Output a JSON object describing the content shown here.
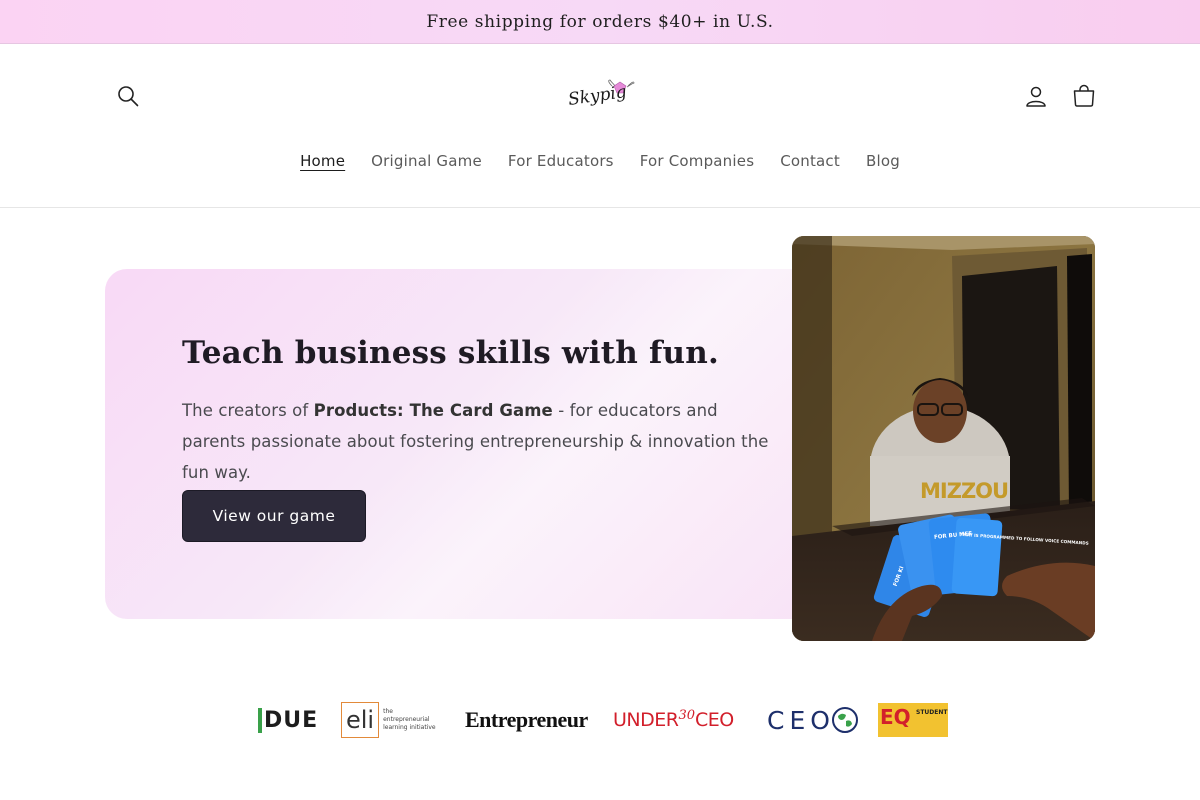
{
  "announcement": {
    "text": "Free shipping for orders $40+ in U.S."
  },
  "header": {
    "logo_text": "Skypig",
    "icons": {
      "search": "search-icon",
      "account": "account-icon",
      "cart": "cart-icon"
    }
  },
  "nav": {
    "items": [
      {
        "label": "Home",
        "active": true
      },
      {
        "label": "Original Game"
      },
      {
        "label": "For Educators"
      },
      {
        "label": "For Companies"
      },
      {
        "label": "Contact"
      },
      {
        "label": "Blog"
      }
    ]
  },
  "hero": {
    "title": "Teach business skills with fun.",
    "desc_prefix": "The creators of ",
    "desc_product": "Products: The Card Game",
    "desc_suffix": " - for educators and parents passionate about fostering entrepreneurship & innovation the fun way.",
    "button_label": "View our game",
    "photo": {
      "sweatshirt_text": "MIZZOU",
      "card_texts": [
        "FOR KI",
        "FOR BU MEE",
        "THAT IS PROGRAMMED TO FOLLOW VOICE COMMANDS"
      ]
    }
  },
  "press_logos": [
    {
      "name": "DUE",
      "text": "DUE"
    },
    {
      "name": "eli",
      "text": "eli",
      "sub": "the entrepreneurial learning initiative"
    },
    {
      "name": "Entrepreneur",
      "text": "Entrepreneur"
    },
    {
      "name": "Under30CEO",
      "text_a": "UNDER",
      "text_b": "30",
      "text_c": "CEO"
    },
    {
      "name": "CEO",
      "text": "CEO"
    },
    {
      "name": "EQ Student",
      "text": "EQ",
      "sub": "STUDENT"
    }
  ],
  "colors": {
    "announcement_bg": "#fbd3f3",
    "button_bg": "#2d2a3a",
    "hero_card": "#f8d9f6",
    "under30_red": "#d21f2b",
    "ceo_navy": "#1d2f6b",
    "due_green": "#3aa14a"
  }
}
